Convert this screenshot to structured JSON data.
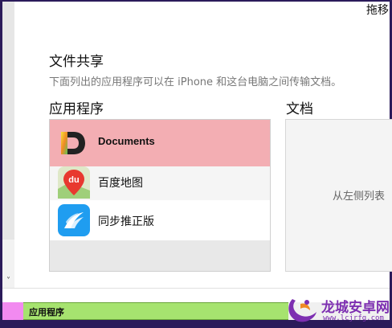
{
  "window": {
    "top_right_label": "拖移",
    "scroll_chevron": "˅"
  },
  "file_sharing": {
    "title": "文件共享",
    "description": "下面列出的应用程序可以在 iPhone 和这台电脑之间传输文档。"
  },
  "apps": {
    "heading": "应用程序",
    "items": [
      {
        "label": "Documents",
        "icon": "documents-app-icon",
        "selected": true
      },
      {
        "label": "百度地图",
        "icon": "baidu-map-app-icon",
        "selected": false
      },
      {
        "label": "同步推正版",
        "icon": "tongbutui-app-icon",
        "selected": false
      }
    ]
  },
  "documents": {
    "heading": "文档",
    "empty_hint": "从左侧列表"
  },
  "bottom_bar": {
    "label": "应用程序"
  },
  "watermark": {
    "title": "龙城安卓网",
    "url": "www.lcjrfg.com"
  },
  "colors": {
    "selected_row": "#f3aeb3",
    "frame": "#2b1b5a",
    "bar_green": "#a6e36f",
    "bar_magenta": "#f28af0",
    "watermark": "#7d2fb1"
  }
}
